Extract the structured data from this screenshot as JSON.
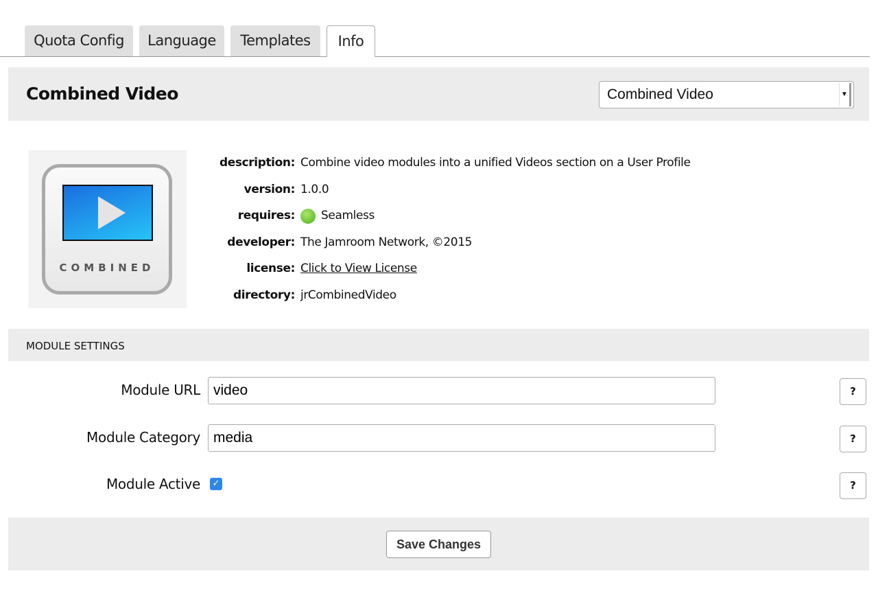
{
  "tabs": [
    {
      "label": "Quota Config"
    },
    {
      "label": "Language"
    },
    {
      "label": "Templates"
    },
    {
      "label": "Info",
      "active": true
    }
  ],
  "header": {
    "title": "Combined Video",
    "module_select": "Combined Video"
  },
  "logo": {
    "caption": "COMBINED"
  },
  "info": {
    "description_label": "description:",
    "description": "Combine video modules into a unified Videos section on a User Profile",
    "version_label": "version:",
    "version": "1.0.0",
    "requires_label": "requires:",
    "requires": "Seamless",
    "developer_label": "developer:",
    "developer": "The Jamroom Network, ©2015",
    "license_label": "license:",
    "license": "Click to View License",
    "directory_label": "directory:",
    "directory": "jrCombinedVideo"
  },
  "settings": {
    "section_title": "MODULE SETTINGS",
    "module_url_label": "Module URL",
    "module_url": "video",
    "module_category_label": "Module Category",
    "module_category": "media",
    "module_active_label": "Module Active",
    "module_active": true,
    "help": "?"
  },
  "footer": {
    "save_label": "Save Changes"
  }
}
